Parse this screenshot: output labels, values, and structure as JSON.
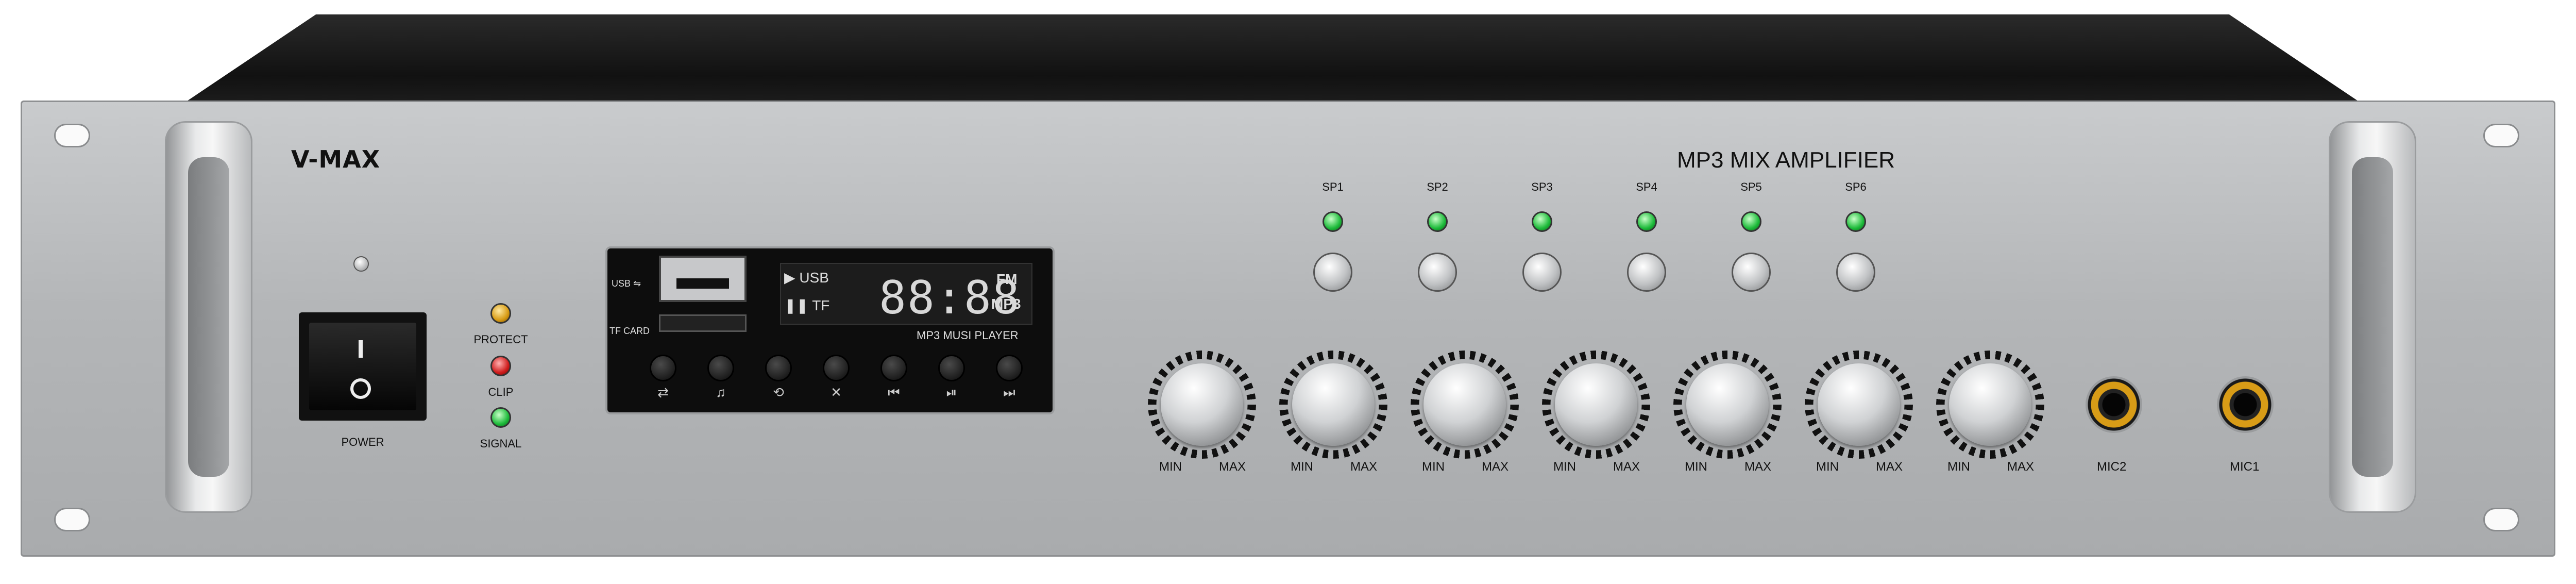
{
  "brand": "V-MAX",
  "model": "MP3 MIX AMPLIFIER",
  "power": {
    "label": "POWER",
    "on_symbol": "I",
    "off_symbol": "O"
  },
  "indicators": [
    {
      "label": "PROTECT",
      "color": "#d79a13"
    },
    {
      "label": "CLIP",
      "color": "#d01d1d"
    },
    {
      "label": "SIGNAL",
      "color": "#1dbb3a"
    }
  ],
  "mp3_player": {
    "title": "MP3 MUSI PLAYER",
    "usb_label": "USB",
    "tf_label": "TF CARD",
    "display": {
      "digits": "88:88",
      "source_top": "USB",
      "source_bottom": "TF",
      "mode_top": "FM",
      "mode_bottom": "MP3"
    },
    "buttons": [
      {
        "icon": "repeat-icon",
        "glyph": "⇄"
      },
      {
        "icon": "music-note-icon",
        "glyph": "♫"
      },
      {
        "icon": "loop-icon",
        "glyph": "⟲"
      },
      {
        "icon": "mute-icon",
        "glyph": "✕"
      },
      {
        "icon": "previous-icon",
        "glyph": "⏮"
      },
      {
        "icon": "play-pause-icon",
        "glyph": "⏯"
      },
      {
        "icon": "next-icon",
        "glyph": "⏭"
      }
    ]
  },
  "zones": [
    "SP1",
    "SP2",
    "SP3",
    "SP4",
    "SP5",
    "SP6"
  ],
  "volume_knobs": {
    "count": 7,
    "min_label": "MIN",
    "max_label": "MAX"
  },
  "mic_inputs": [
    "MIC2",
    "MIC1"
  ]
}
